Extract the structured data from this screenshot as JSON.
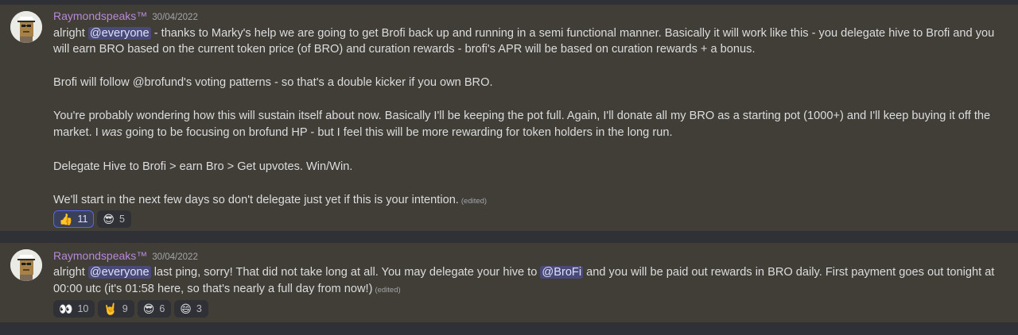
{
  "messages": [
    {
      "username": "Raymondspeaks™",
      "timestamp": "30/04/2022",
      "lines": [
        {
          "prefix": "alright ",
          "mention": "@everyone",
          "suffix": " - thanks to Marky's help we are going to get Brofi back up and running in a semi functional manner. Basically it will work like this - you delegate hive to Brofi and you"
        },
        "will earn BRO based on the current token price (of BRO) and curation rewards - brofi's APR will be based on curation rewards + a bonus.",
        "Brofi will follow @brofund's voting patterns - so that's a double kicker if you own BRO.",
        "You're probably wondering how this will sustain itself about now. Basically I'll be keeping the pot full. Again, I'll donate all my BRO as a starting pot (1000+) and I'll keep buying it off the",
        {
          "before": "market. I ",
          "italic": "was",
          "after": " going to be focusing on brofund HP - but I feel this will be more rewarding for token holders in the long run."
        },
        "Delegate Hive to Brofi > earn Bro > Get upvotes. Win/Win.",
        {
          "text": "We'll start in the next few days so don't delegate just yet if this is your intention.",
          "edited": "(edited)"
        }
      ],
      "reactions": [
        {
          "emoji": "👍",
          "icon": "thumbs-up-icon",
          "count": "11",
          "active": true
        },
        {
          "emoji": "😎",
          "icon": "sunglasses-face-icon",
          "count": "5",
          "active": false
        }
      ]
    },
    {
      "username": "Raymondspeaks™",
      "timestamp": "30/04/2022",
      "lines": [
        {
          "prefix": "alright ",
          "mention": "@everyone",
          "middle": " last ping, sorry! That did not take long at all. You may delegate your hive to ",
          "mention2": "@BroFi",
          "suffix": " and you will be paid out rewards in BRO daily. First payment goes out tonight at"
        },
        {
          "text": "00:00 utc (it's 01:58 here, so that's nearly a full day from now!)",
          "edited": "(edited)"
        }
      ],
      "reactions": [
        {
          "emoji": "👀",
          "icon": "eyes-icon",
          "count": "10",
          "active": false
        },
        {
          "emoji": "🤘",
          "icon": "rock-hand-icon",
          "count": "9",
          "active": false
        },
        {
          "emoji": "😎",
          "icon": "sunglasses-face-icon",
          "count": "6",
          "active": false
        },
        {
          "emoji": "😄",
          "icon": "grin-face-icon",
          "count": "3",
          "active": false
        }
      ]
    }
  ],
  "colors": {
    "background": "#2f3136",
    "message_highlight": "#413d37",
    "username": "#b68ad9",
    "mention_bg": "#5865f2"
  }
}
